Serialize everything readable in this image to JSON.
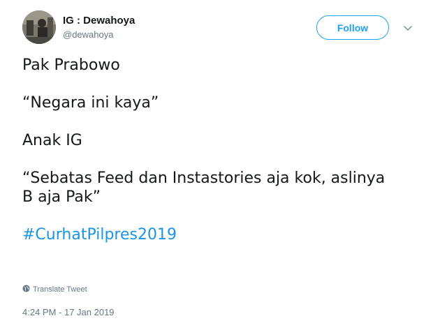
{
  "author": {
    "name": "IG : Dewahoya",
    "handle": "@dewahoya"
  },
  "actions": {
    "follow_label": "Follow",
    "more_icon": "chevron-down-icon"
  },
  "tweet": {
    "lines": [
      "Pak Prabowo",
      "“Negara ini kaya”",
      "Anak IG",
      "“Sebatas Feed dan Instastories aja kok, aslinya",
      "B aja Pak”"
    ],
    "hashtag": "#CurhatPilpres2019"
  },
  "footer": {
    "translate_label": "Translate Tweet",
    "translate_icon": "globe-icon",
    "timestamp": "4:24 PM - 17 Jan 2019"
  },
  "colors": {
    "accent": "#1da1f2",
    "hashtag": "#1b95e0",
    "muted": "#657786",
    "text": "#14171a"
  }
}
